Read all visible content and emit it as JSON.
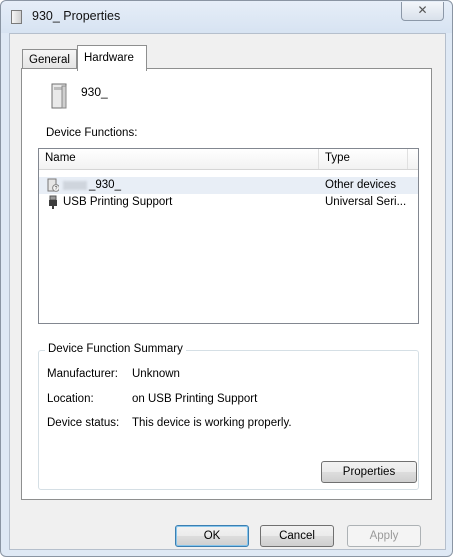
{
  "window": {
    "title": "930_ Properties",
    "close_label": "✕"
  },
  "tabs": [
    {
      "label": "General"
    },
    {
      "label": "Hardware"
    }
  ],
  "device": {
    "name": "930_"
  },
  "device_functions": {
    "label": "Device Functions:",
    "columns": [
      "Name",
      "Type"
    ],
    "rows": [
      {
        "name": "_930_",
        "type": "Other devices",
        "icon": "unknown-device-icon",
        "selected": true
      },
      {
        "name": "USB Printing Support",
        "type": "Universal Seri...",
        "icon": "usb-plug-icon",
        "selected": false
      }
    ]
  },
  "summary": {
    "title": "Device Function Summary",
    "manufacturer_label": "Manufacturer:",
    "manufacturer_value": "Unknown",
    "location_label": "Location:",
    "location_value": "on USB Printing Support",
    "status_label": "Device status:",
    "status_value": "This device is working properly.",
    "properties_button": "Properties"
  },
  "buttons": {
    "ok": "OK",
    "cancel": "Cancel",
    "apply": "Apply"
  }
}
